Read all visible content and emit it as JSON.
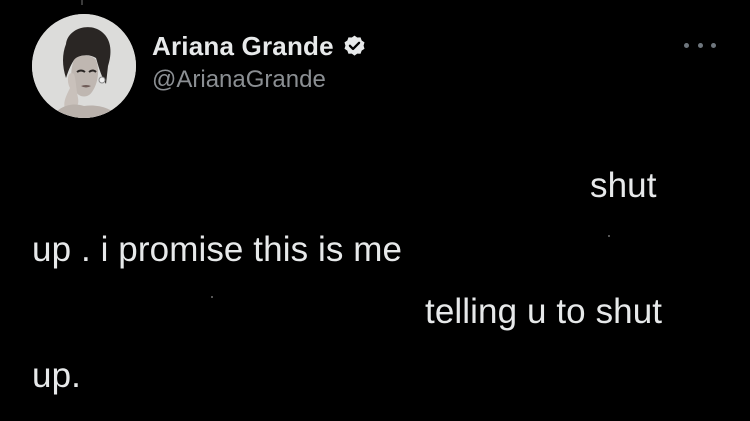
{
  "author": {
    "display_name": "Ariana Grande",
    "handle": "@ArianaGrande",
    "verified": true
  },
  "icons": {
    "verified": "verified-badge-icon",
    "more": "more-options-icon"
  },
  "tweet": {
    "lines": [
      "shut",
      "up . i promise this is me",
      "telling u to shut",
      "up."
    ]
  },
  "colors": {
    "background": "#000000",
    "text": "#e7e9ea",
    "secondary": "#8b8f93"
  }
}
